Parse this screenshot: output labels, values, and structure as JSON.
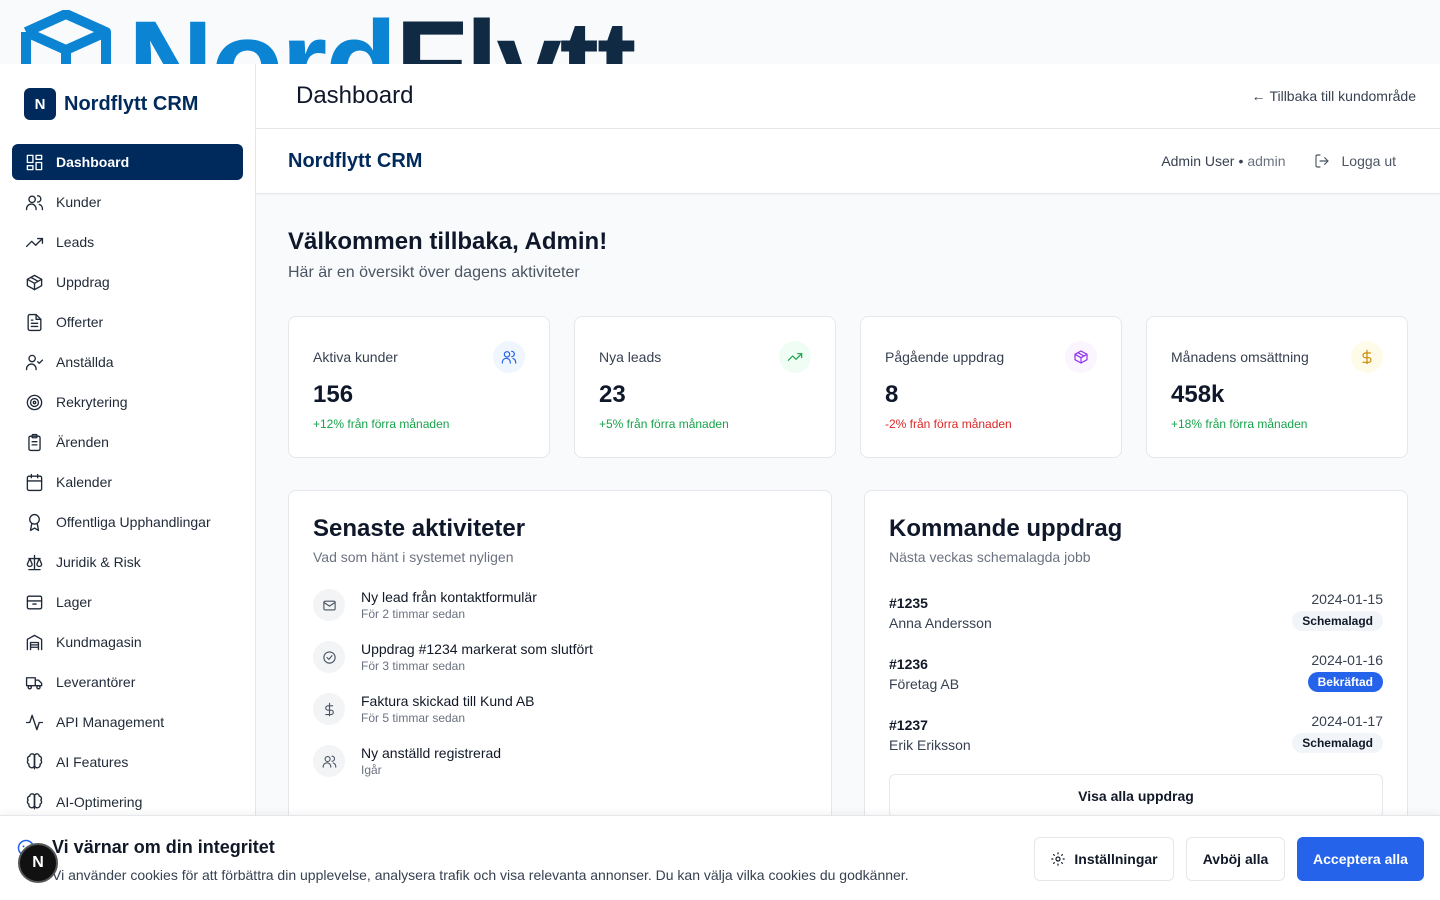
{
  "banner": {
    "word_part1": "Nord",
    "word_part2": "Flytt"
  },
  "sidebar": {
    "logo_letter": "N",
    "brand": "Nordflytt CRM",
    "items": [
      {
        "label": "Dashboard",
        "icon": "dashboard-grid-icon",
        "active": true
      },
      {
        "label": "Kunder",
        "icon": "users-icon"
      },
      {
        "label": "Leads",
        "icon": "trending-up-icon"
      },
      {
        "label": "Uppdrag",
        "icon": "package-icon"
      },
      {
        "label": "Offerter",
        "icon": "document-icon"
      },
      {
        "label": "Anställda",
        "icon": "user-check-icon"
      },
      {
        "label": "Rekrytering",
        "icon": "target-icon"
      },
      {
        "label": "Ärenden",
        "icon": "clipboard-icon"
      },
      {
        "label": "Kalender",
        "icon": "calendar-icon"
      },
      {
        "label": "Offentliga Upphandlingar",
        "icon": "award-icon"
      },
      {
        "label": "Juridik & Risk",
        "icon": "scale-icon"
      },
      {
        "label": "Lager",
        "icon": "box-icon"
      },
      {
        "label": "Kundmagasin",
        "icon": "warehouse-icon"
      },
      {
        "label": "Leverantörer",
        "icon": "truck-icon"
      },
      {
        "label": "API Management",
        "icon": "activity-icon"
      },
      {
        "label": "AI Features",
        "icon": "brain-icon"
      },
      {
        "label": "AI-Optimering",
        "icon": "brain-icon"
      }
    ]
  },
  "header": {
    "title": "Dashboard",
    "back_link": "Tillbaka till kundområde",
    "back_arrow": "←"
  },
  "subheader": {
    "brand": "Nordflytt CRM",
    "user_name": "Admin User",
    "separator": "•",
    "user_role": "admin",
    "logout": "Logga ut"
  },
  "welcome": {
    "title": "Välkommen tillbaka, Admin!",
    "subtitle": "Här är en översikt över dagens aktiviteter"
  },
  "stats": [
    {
      "label": "Aktiva kunder",
      "value": "156",
      "trend": "+12% från förra månaden",
      "direction": "up",
      "icon": "users-icon",
      "icon_color": "#2563eb",
      "icon_bg": "#eff6ff"
    },
    {
      "label": "Nya leads",
      "value": "23",
      "trend": "+5% från förra månaden",
      "direction": "up",
      "icon": "trending-up-icon",
      "icon_color": "#16a34a",
      "icon_bg": "#f0fdf4"
    },
    {
      "label": "Pågående uppdrag",
      "value": "8",
      "trend": "-2% från förra månaden",
      "direction": "down",
      "icon": "package-icon",
      "icon_color": "#9333ea",
      "icon_bg": "#faf5ff"
    },
    {
      "label": "Månadens omsättning",
      "value": "458k",
      "trend": "+18% från förra månaden",
      "direction": "up",
      "icon": "dollar-icon",
      "icon_color": "#ca8a04",
      "icon_bg": "#fefce8"
    }
  ],
  "activities": {
    "title": "Senaste aktiviteter",
    "subtitle": "Vad som hänt i systemet nyligen",
    "items": [
      {
        "title": "Ny lead från kontaktformulär",
        "time": "För 2 timmar sedan",
        "icon": "mail-icon"
      },
      {
        "title": "Uppdrag #1234 markerat som slutfört",
        "time": "För 3 timmar sedan",
        "icon": "check-circle-icon"
      },
      {
        "title": "Faktura skickad till Kund AB",
        "time": "För 5 timmar sedan",
        "icon": "dollar-icon"
      },
      {
        "title": "Ny anställd registrerad",
        "time": "Igår",
        "icon": "users-icon"
      }
    ]
  },
  "upcoming": {
    "title": "Kommande uppdrag",
    "subtitle": "Nästa veckas schemalagda jobb",
    "jobs": [
      {
        "id": "#1235",
        "client": "Anna Andersson",
        "date": "2024-01-15",
        "status": "Schemalagd",
        "status_type": "scheduled"
      },
      {
        "id": "#1236",
        "client": "Företag AB",
        "date": "2024-01-16",
        "status": "Bekräftad",
        "status_type": "confirmed"
      },
      {
        "id": "#1237",
        "client": "Erik Eriksson",
        "date": "2024-01-17",
        "status": "Schemalagd",
        "status_type": "scheduled"
      }
    ],
    "view_all": "Visa alla uppdrag"
  },
  "cookie": {
    "title": "Vi värnar om din integritet",
    "text": "Vi använder cookies för att förbättra din upplevelse, analysera trafik och visa relevanta annonser. Du kan välja vilka cookies du godkänner.",
    "settings": "Inställningar",
    "reject": "Avböj alla",
    "accept": "Acceptera alla"
  },
  "fab_letter": "N",
  "colors": {
    "brand": "#002a5c",
    "accent": "#2563eb",
    "success": "#16a34a",
    "danger": "#dc2626"
  }
}
